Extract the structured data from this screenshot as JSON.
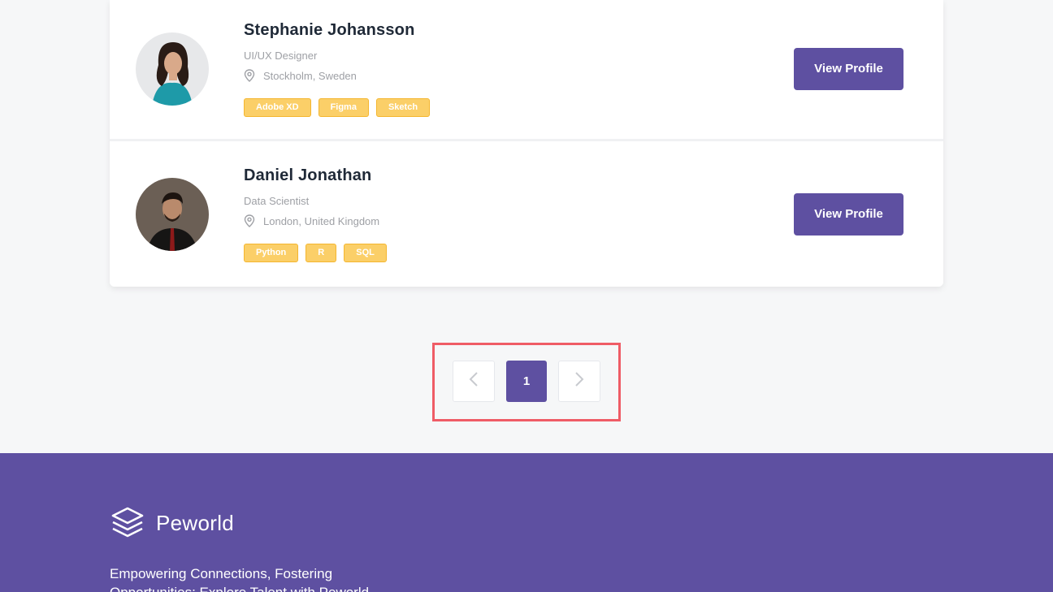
{
  "profiles": [
    {
      "name": "Stephanie Johansson",
      "title": "UI/UX Designer",
      "location": "Stockholm, Sweden",
      "skills": [
        "Adobe XD",
        "Figma",
        "Sketch"
      ],
      "button": "View Profile"
    },
    {
      "name": "Daniel Jonathan",
      "title": "Data Scientist",
      "location": "London, United Kingdom",
      "skills": [
        "Python",
        "R",
        "SQL"
      ],
      "button": "View Profile"
    }
  ],
  "pagination": {
    "current_page": "1",
    "prev_icon": "chevron-left-icon",
    "next_icon": "chevron-right-icon"
  },
  "footer": {
    "brand": "Peworld",
    "tagline": "Empowering Connections, Fostering Opportunities: Explore Talent with Peworld",
    "logo_icon": "layers-icon"
  },
  "colors": {
    "primary": "#5e50a1",
    "skill_badge": "#fbcf68",
    "highlight": "#ef5c66",
    "background": "#f6f7f8"
  }
}
